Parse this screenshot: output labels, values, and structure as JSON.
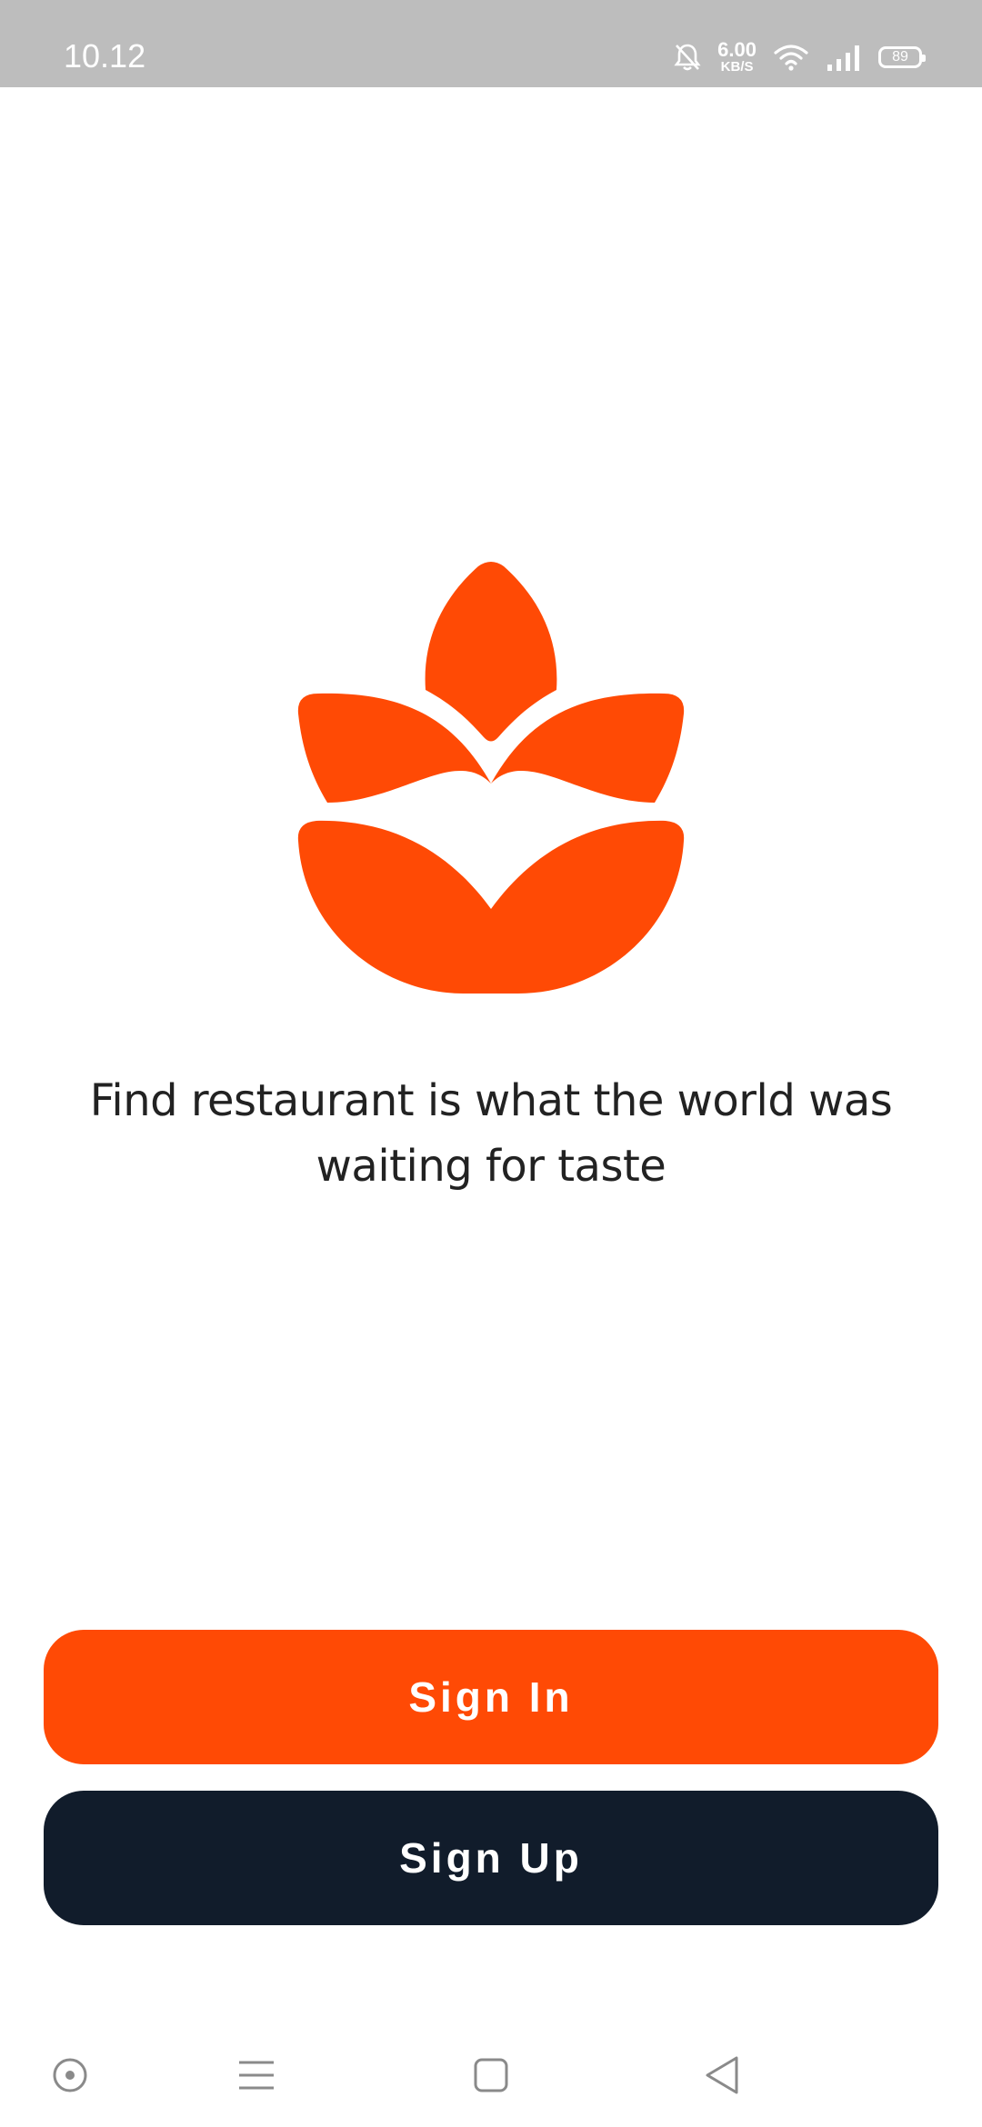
{
  "status_bar": {
    "time": "10.12",
    "net_speed_value": "6.00",
    "net_speed_unit": "KB/S",
    "battery": "89",
    "icons": [
      "bell-off-icon",
      "wifi-icon",
      "signal-icon",
      "battery-icon"
    ]
  },
  "brand": {
    "logo_icon": "lotus-leaf-icon",
    "accent_color": "#ff4a05",
    "dark_color": "#111c2b"
  },
  "tagline": "Find restaurant is what the world was waiting for taste",
  "buttons": {
    "sign_in": "Sign In",
    "sign_up": "Sign Up"
  },
  "nav_bar": {
    "icons": [
      "assistant-icon",
      "menu-icon",
      "home-square-icon",
      "back-triangle-icon"
    ]
  }
}
